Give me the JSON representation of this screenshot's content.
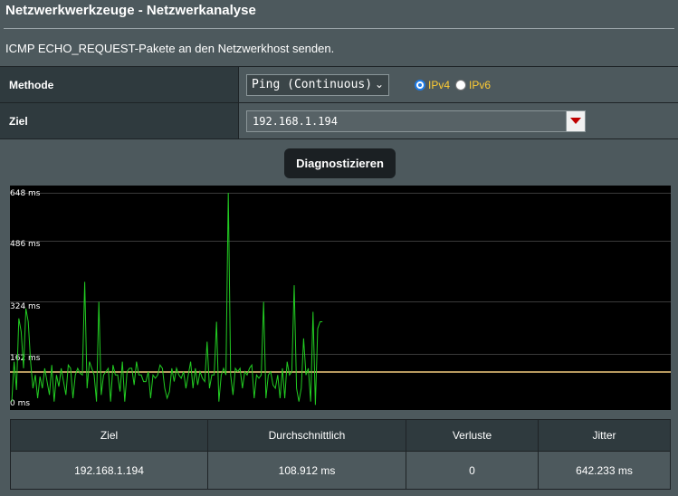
{
  "header": {
    "title": "Netzwerkwerkzeuge - Netzwerkanalyse",
    "description": "ICMP ECHO_REQUEST-Pakete an den Netzwerkhost senden."
  },
  "form": {
    "method": {
      "label": "Methode",
      "selected": "Ping (Continuous)",
      "ipv4_label": "IPv4",
      "ipv6_label": "IPv6",
      "ipv4_checked": true
    },
    "target": {
      "label": "Ziel",
      "value": "192.168.1.194"
    }
  },
  "diagnose_button": "Diagnostizieren",
  "colors": {
    "line": "#22cc22",
    "average": "#b89a60",
    "radio": "#1e7be6",
    "radio_label": "#ffcc33"
  },
  "chart_data": {
    "type": "line",
    "y_tick_labels": [
      "648 ms",
      "486 ms",
      "324 ms",
      "162 ms",
      "0 ms"
    ],
    "ylim": [
      0,
      648
    ],
    "average": 108.912,
    "series": [
      {
        "values": [
          20,
          140,
          55,
          270,
          230,
          120,
          300,
          260,
          140,
          60,
          100,
          30,
          95,
          60,
          120,
          80,
          40,
          130,
          20,
          100,
          65,
          120,
          80,
          40,
          130,
          120,
          30,
          100,
          120,
          105,
          100,
          380,
          60,
          140,
          120,
          100,
          20,
          320,
          40,
          100,
          110,
          120,
          20,
          130,
          100,
          100,
          50,
          140,
          20,
          110,
          120,
          120,
          70,
          140,
          100,
          100,
          80,
          80,
          110,
          30,
          100,
          90,
          100,
          130,
          120,
          60,
          30,
          50,
          120,
          80,
          120,
          100,
          90,
          110,
          60,
          100,
          140,
          60,
          120,
          70,
          110,
          90,
          80,
          200,
          60,
          100,
          100,
          260,
          20,
          100,
          120,
          100,
          650,
          100,
          40,
          120,
          110,
          120,
          60,
          110,
          100,
          120,
          130,
          30,
          100,
          90,
          100,
          320,
          30,
          100,
          110,
          70,
          60,
          100,
          30,
          120,
          30,
          140,
          100,
          110,
          370,
          60,
          20,
          60,
          210,
          100,
          120,
          20,
          290,
          10,
          240,
          260,
          260
        ]
      }
    ]
  },
  "stats": {
    "headers": [
      "Ziel",
      "Durchschnittlich",
      "Verluste",
      "Jitter"
    ],
    "row": [
      "192.168.1.194",
      "108.912 ms",
      "0",
      "642.233 ms"
    ]
  }
}
